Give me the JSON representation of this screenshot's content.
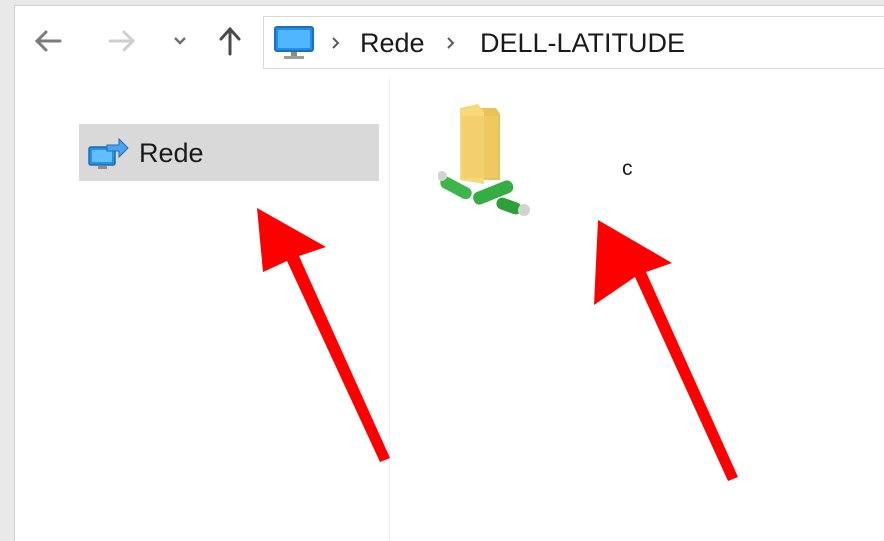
{
  "nav": {
    "back_icon": "arrow-left-icon",
    "forward_icon": "arrow-right-icon",
    "recent_icon": "chevron-down-icon",
    "up_icon": "arrow-up-icon"
  },
  "address": {
    "location_icon": "this-pc-icon",
    "crumbs": [
      "Rede",
      "DELL-LATITUDE"
    ]
  },
  "sidebar": {
    "items": [
      {
        "label": "Rede",
        "icon": "network-icon",
        "selected": true
      }
    ]
  },
  "content": {
    "items": [
      {
        "label": "c",
        "icon": "shared-folder-icon"
      }
    ]
  },
  "annotations": {
    "color": "#ff0000",
    "arrows": [
      "sidebar-network",
      "shared-folder"
    ]
  }
}
